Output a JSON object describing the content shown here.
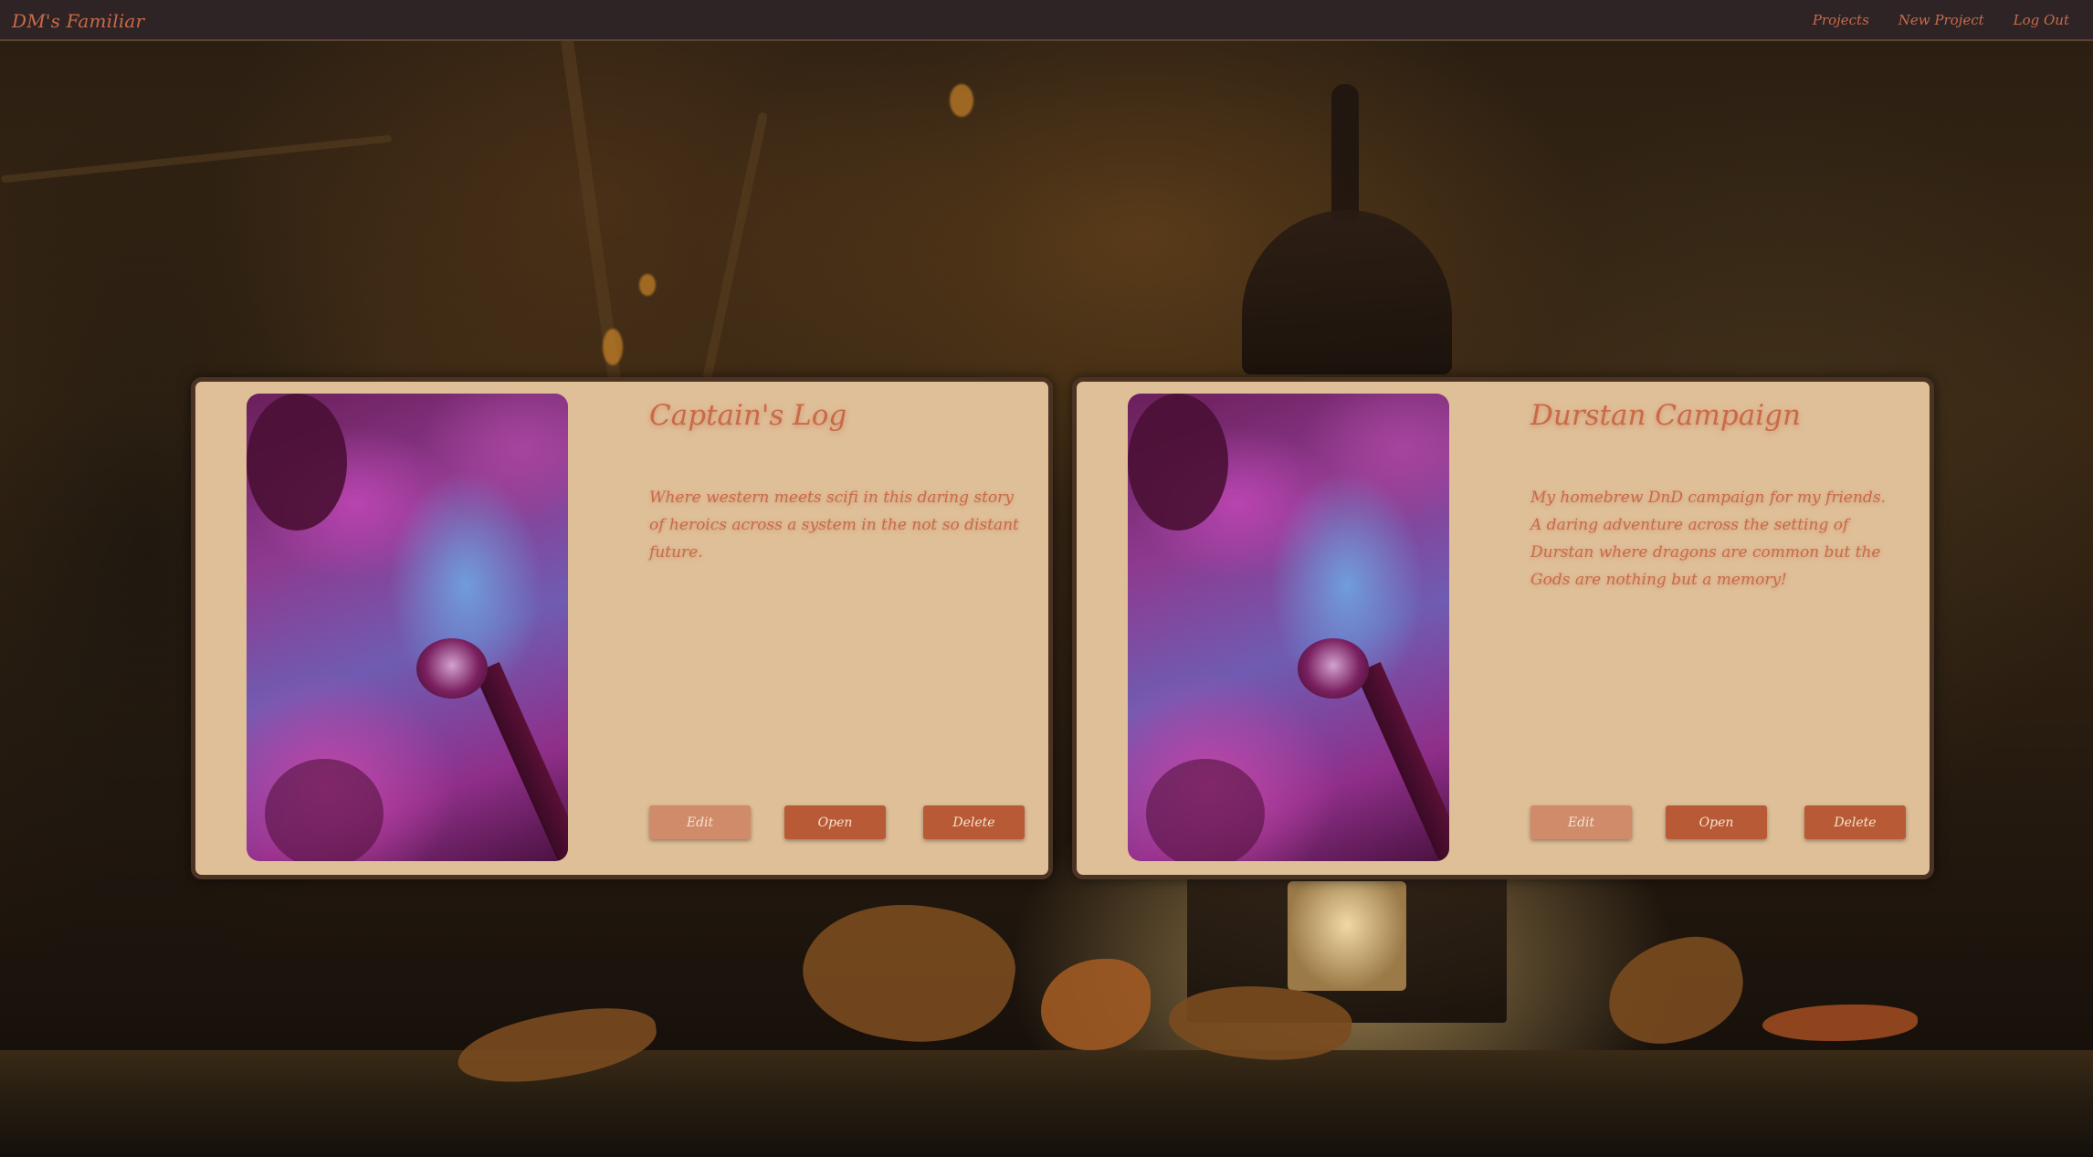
{
  "navbar": {
    "brand": "DM's Familiar",
    "links": [
      "Projects",
      "New Project",
      "Log Out"
    ]
  },
  "projects": [
    {
      "title": "Captain's Log",
      "description": "Where western meets scifi in this daring story of heroics across a system in the not so distant future.",
      "buttons": {
        "edit": "Edit",
        "open": "Open",
        "delete": "Delete"
      }
    },
    {
      "title": "Durstan Campaign",
      "description": "My homebrew DnD campaign for my friends. A daring adventure across the setting of Durstan where dragons are common but the Gods are nothing but a memory!",
      "buttons": {
        "edit": "Edit",
        "open": "Open",
        "delete": "Delete"
      }
    }
  ],
  "colors": {
    "navbar_bg": "#2e2426",
    "accent_text": "#c86a47",
    "card_bg": "#dfbf98",
    "card_border": "#4b3323",
    "button_primary": "#b85a35",
    "button_secondary": "#d08b6b"
  },
  "icons": {
    "background": "autumn-lantern-scene",
    "card_image": "purple-forest-lamp-image"
  }
}
